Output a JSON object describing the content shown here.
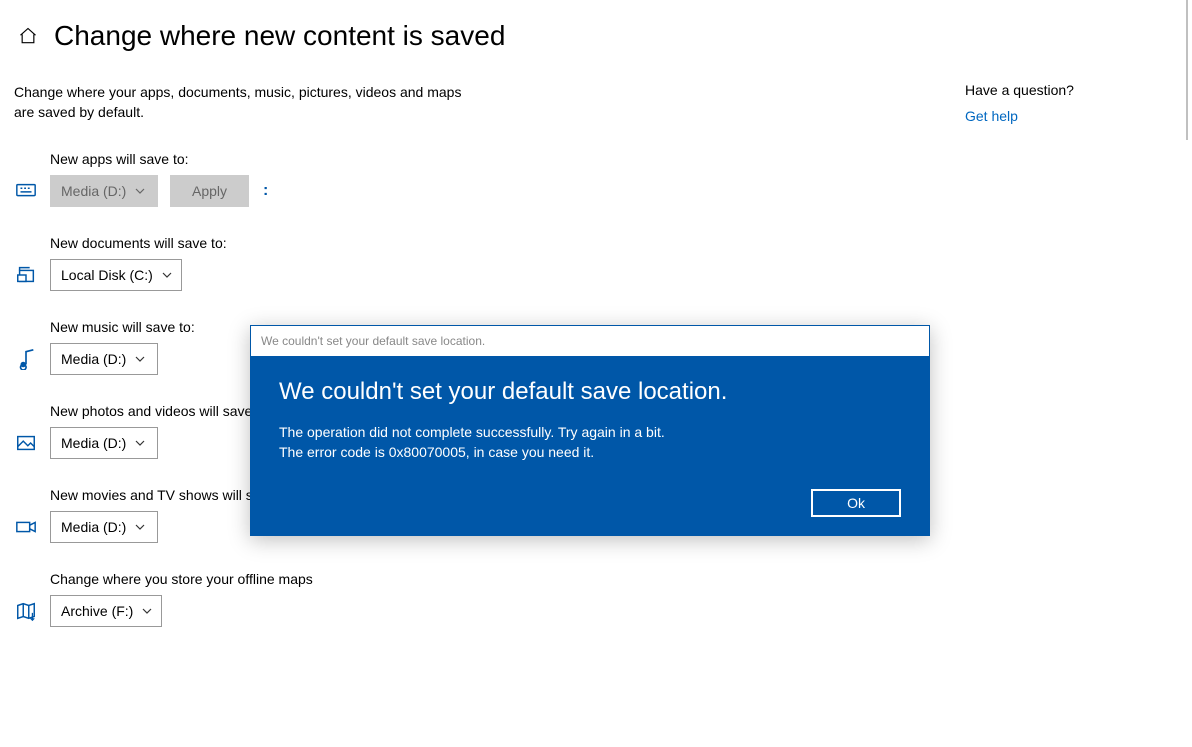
{
  "header": {
    "title": "Change where new content is saved"
  },
  "description": "Change where your apps, documents, music, pictures, videos and maps are saved by default.",
  "settings": {
    "apps": {
      "label": "New apps will save to:",
      "value": "Media (D:)",
      "apply_label": "Apply"
    },
    "documents": {
      "label": "New documents will save to:",
      "value": "Local Disk (C:)"
    },
    "music": {
      "label": "New music will save to:",
      "value": "Media (D:)"
    },
    "photos": {
      "label": "New photos and videos will save to:",
      "value": "Media (D:)"
    },
    "movies": {
      "label": "New movies and TV shows will save to:",
      "value": "Media (D:)"
    },
    "maps": {
      "label": "Change where you store your offline maps",
      "value": "Archive (F:)"
    }
  },
  "help": {
    "question": "Have a question?",
    "link": "Get help"
  },
  "dialog": {
    "window_title": "We couldn't set your default save location.",
    "heading": "We couldn't set your default save location.",
    "line1": "The operation did not complete successfully. Try again in a bit.",
    "line2": "The error code is 0x80070005, in case you need it.",
    "ok": "Ok"
  }
}
